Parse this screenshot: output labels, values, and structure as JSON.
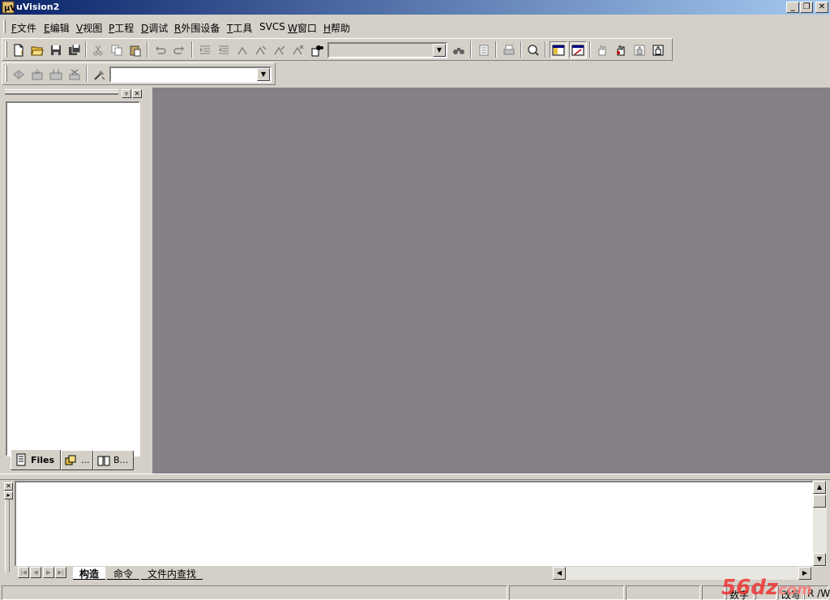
{
  "window": {
    "title": "uVision2",
    "controls": {
      "minimize": "_",
      "restore": "❐",
      "close": "✕"
    }
  },
  "menu": [
    {
      "acc": "F",
      "label": "文件"
    },
    {
      "acc": "E",
      "label": "编辑"
    },
    {
      "acc": "V",
      "label": "视图"
    },
    {
      "acc": "P",
      "label": "工程"
    },
    {
      "acc": "D",
      "label": "调试"
    },
    {
      "acc": "R",
      "label": "外围设备"
    },
    {
      "acc": "T",
      "label": "工具"
    },
    {
      "acc": "",
      "label": "SVCS"
    },
    {
      "acc": "W",
      "label": "窗口"
    },
    {
      "acc": "H",
      "label": "帮助"
    }
  ],
  "toolbar_main": {
    "find_combo_value": "",
    "icons": [
      "new-file-icon",
      "open-folder-icon",
      "save-icon",
      "save-all-icon",
      "cut-icon",
      "copy-icon",
      "paste-icon",
      "undo-icon",
      "redo-icon",
      "indent-icon",
      "unindent-icon",
      "bookmark-icon",
      "bookmark-next-icon",
      "bookmark-prev-icon",
      "bookmark-clear-icon",
      "find-in-files-icon",
      "find-icon",
      "incremental-find-icon",
      "print-icon",
      "zoom-icon",
      "workspace-window-icon",
      "output-window-icon",
      "hand-icon",
      "build-hand-icon",
      "stop-hand-icon",
      "hand-grab-icon"
    ]
  },
  "toolbar_build": {
    "target_combo_value": "",
    "icons": [
      "translate-icon",
      "build-icon",
      "rebuild-icon",
      "stop-build-icon",
      "target-options-icon"
    ]
  },
  "project_panel": {
    "tabs": [
      {
        "label": "Files",
        "icon": "files-tab-icon",
        "active": true
      },
      {
        "label": "...",
        "icon": "regs-tab-icon",
        "active": false
      },
      {
        "label": "B...",
        "icon": "books-tab-icon",
        "active": false
      }
    ]
  },
  "output_panel": {
    "tabs": [
      {
        "label": "构造",
        "active": true
      },
      {
        "label": "命令",
        "active": false
      },
      {
        "label": "文件内查找",
        "active": false
      }
    ]
  },
  "statusbar": {
    "num": "数字",
    "ovr": "改写",
    "rw": "R /W"
  },
  "watermark": {
    "text": "56dz",
    "suffix": "com"
  },
  "colors": {
    "titlebar_start": "#0a246a",
    "titlebar_end": "#a6caf0",
    "mdi_background": "#858085",
    "chrome": "#d4d0c8"
  }
}
